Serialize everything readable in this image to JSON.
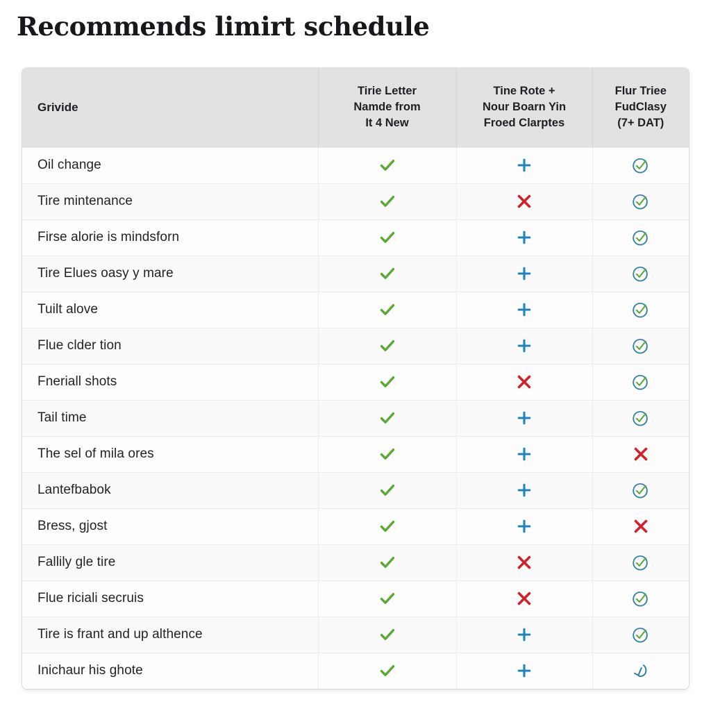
{
  "title": "Recommends limirt schedule",
  "table": {
    "headers": {
      "service": "Grivide",
      "col2": [
        "Tirie Letter",
        "Namde from",
        "It 4 New"
      ],
      "col3": [
        "Tine Rote +",
        "Nour Boarn Yin",
        "Froed Clarptes"
      ],
      "col4": [
        "Flur Triee",
        "FudClasy",
        "(7+ DAT)"
      ]
    },
    "icons": {
      "check": "green-check-icon",
      "plus": "blue-plus-icon",
      "cross": "red-cross-icon",
      "circle_check": "green-circle-check-icon",
      "broken_circle_check": "broken-circle-check-icon"
    },
    "colors": {
      "check_green": "#5aa832",
      "plus_blue": "#1a85c0",
      "cross_red": "#d42028",
      "circle_blue": "#2f80a8",
      "header_bg": "#e2e2e3",
      "row_border": "#ececee",
      "text": "#1f2226"
    },
    "rows": [
      {
        "service": "Oil change",
        "col2": "check",
        "col3": "plus",
        "col4": "circle_check"
      },
      {
        "service": "Tire mintenance",
        "col2": "check",
        "col3": "cross",
        "col4": "circle_check"
      },
      {
        "service": "Firse alorie is mindsforn",
        "col2": "check",
        "col3": "plus",
        "col4": "circle_check"
      },
      {
        "service": "Tire Elues oasy y mare",
        "col2": "check",
        "col3": "plus",
        "col4": "circle_check"
      },
      {
        "service": "Tuilt alove",
        "col2": "check",
        "col3": "plus",
        "col4": "circle_check"
      },
      {
        "service": "Flue clder tion",
        "col2": "check",
        "col3": "plus",
        "col4": "circle_check"
      },
      {
        "service": "Fneriall shots",
        "col2": "check",
        "col3": "cross",
        "col4": "circle_check"
      },
      {
        "service": "Tail time",
        "col2": "check",
        "col3": "plus",
        "col4": "circle_check"
      },
      {
        "service": "The sel of mila ores",
        "col2": "check",
        "col3": "plus",
        "col4": "cross"
      },
      {
        "service": "Lantefbabok",
        "col2": "check",
        "col3": "plus",
        "col4": "circle_check"
      },
      {
        "service": "Bress, gjost",
        "col2": "check",
        "col3": "plus",
        "col4": "cross"
      },
      {
        "service": "Fallily gle tire",
        "col2": "check",
        "col3": "cross",
        "col4": "circle_check"
      },
      {
        "service": "Flue riciali secruis",
        "col2": "check",
        "col3": "cross",
        "col4": "circle_check"
      },
      {
        "service": "Tire is frant and up althence",
        "col2": "check",
        "col3": "plus",
        "col4": "circle_check"
      },
      {
        "service": "Inichaur his ghote",
        "col2": "check",
        "col3": "plus",
        "col4": "broken_circle_check"
      }
    ]
  }
}
